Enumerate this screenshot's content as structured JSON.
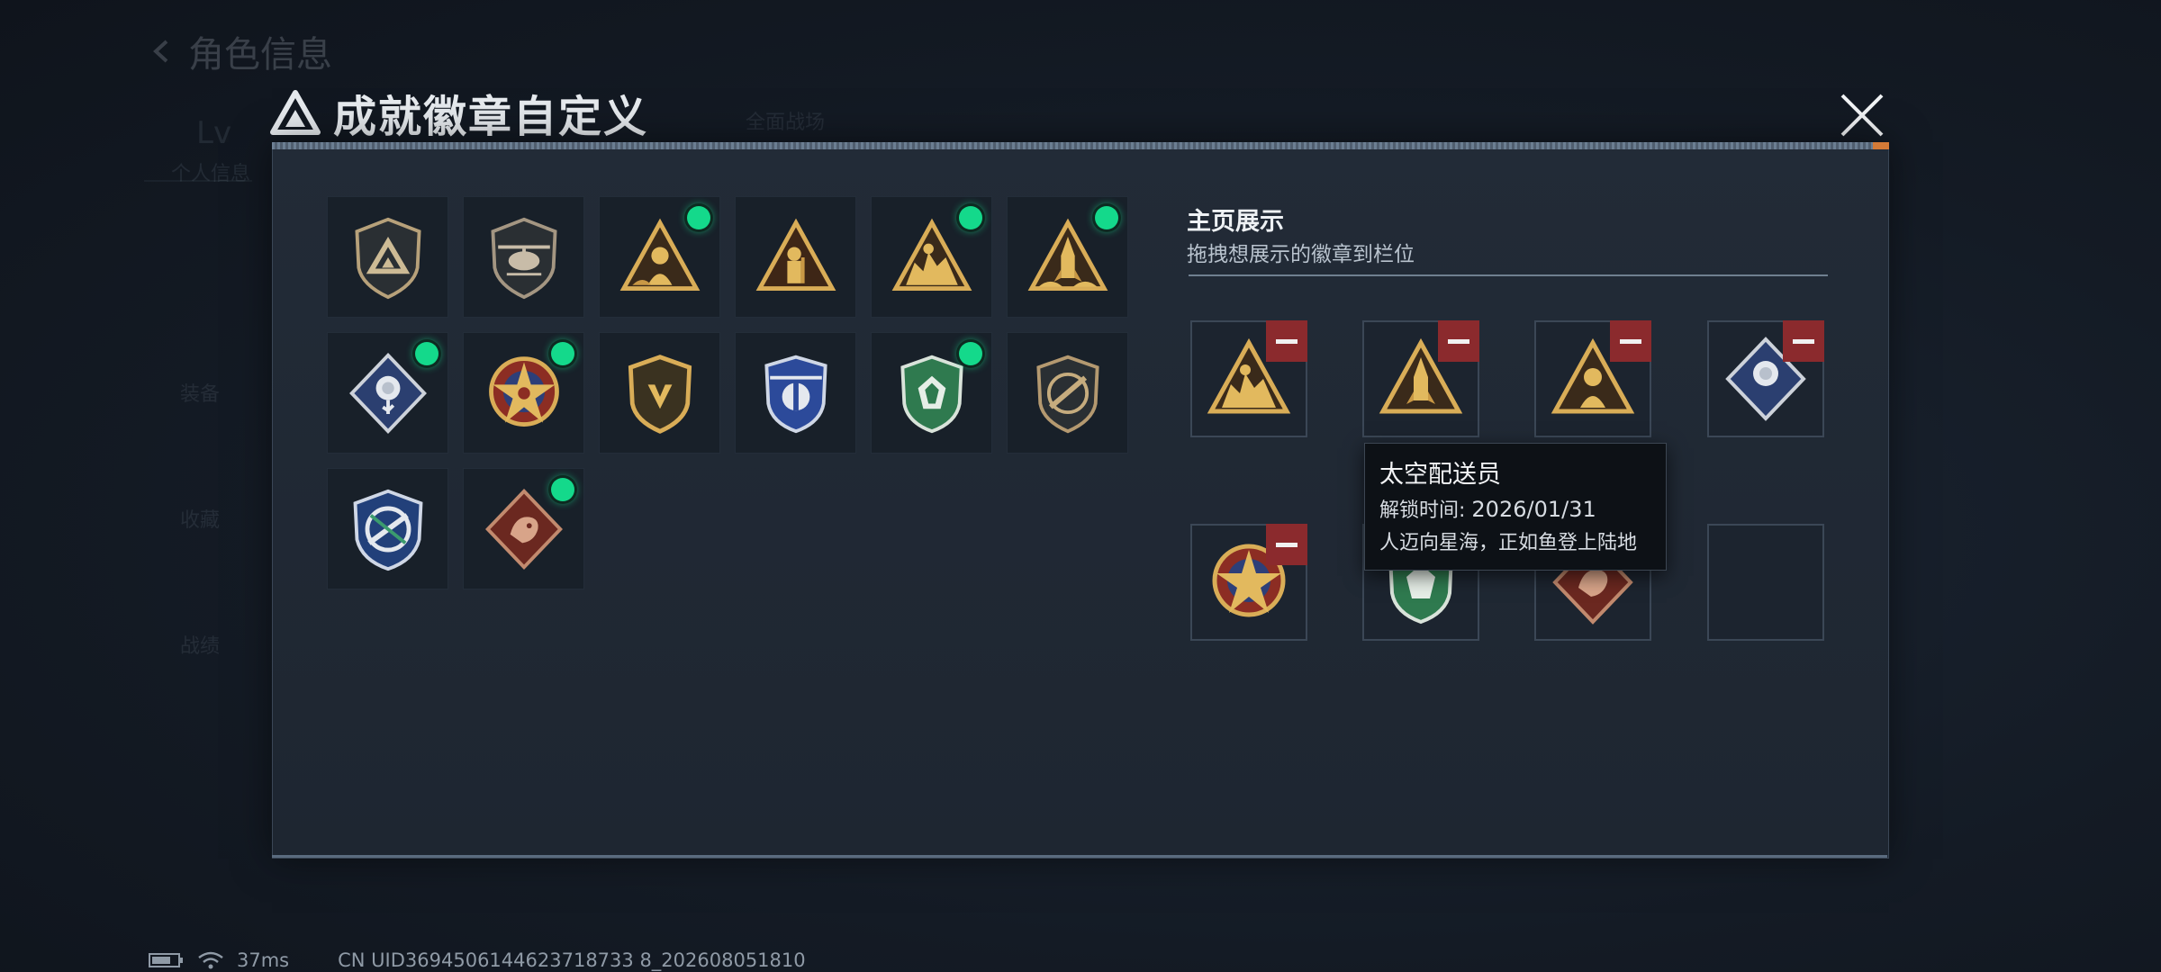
{
  "background": {
    "title": "角色信息",
    "ghost_texts": [
      "全面战场",
      "Lv",
      "个人信息",
      "装备",
      "收藏",
      "战绩"
    ]
  },
  "modal": {
    "title": "成就徽章自定义",
    "close_icon": "close-icon"
  },
  "badges": [
    {
      "name": "triangle-shield-badge",
      "equipped": false
    },
    {
      "name": "helicopter-shield-badge",
      "equipped": false
    },
    {
      "name": "gold-triangle-astronaut-badge",
      "equipped": true
    },
    {
      "name": "gold-triangle-soldier-badge",
      "equipped": false
    },
    {
      "name": "gold-triangle-creatures-badge",
      "equipped": true
    },
    {
      "name": "gold-triangle-rocket-badge",
      "equipped": true
    },
    {
      "name": "blue-diamond-rose-badge",
      "equipped": true
    },
    {
      "name": "star-emblem-badge",
      "equipped": true
    },
    {
      "name": "gold-shield-badge",
      "equipped": false
    },
    {
      "name": "blue-winged-shield-badge",
      "equipped": false
    },
    {
      "name": "green-shield-badge",
      "equipped": true
    },
    {
      "name": "rifle-shield-badge",
      "equipped": false
    },
    {
      "name": "blue-rocket-emblem-badge",
      "equipped": false
    },
    {
      "name": "red-dragon-diamond-badge",
      "equipped": true
    }
  ],
  "showcase": {
    "title": "主页展示",
    "subtitle": "拖拽想展示的徽章到栏位",
    "slots": [
      {
        "badge": "gold-triangle-creatures-badge",
        "filled": true
      },
      {
        "badge": "gold-triangle-rocket-badge",
        "filled": true
      },
      {
        "badge": "gold-triangle-astronaut-badge",
        "filled": true
      },
      {
        "badge": "blue-diamond-rose-badge",
        "filled": true
      },
      {
        "badge": "star-emblem-badge",
        "filled": true
      },
      {
        "badge": "green-shield-badge",
        "filled": true
      },
      {
        "badge": "red-dragon-diamond-badge",
        "filled": true
      },
      {
        "badge": "",
        "filled": false
      }
    ]
  },
  "tooltip": {
    "name": "太空配送员",
    "unlock_label": "解锁时间: ",
    "unlock_date": "2026/01/31",
    "description": "人迈向星海，正如鱼登上陆地"
  },
  "footer": {
    "battery_icon": "battery-icon",
    "wifi_icon": "wifi-icon",
    "ping": "37ms",
    "uid": "CN UID3694506144623718733 8_202608051810"
  },
  "colors": {
    "equipped_dot": "#14d98b",
    "remove_button": "#8b2a2d",
    "gold": "#c9a352",
    "panel_bg": "#212a35"
  }
}
